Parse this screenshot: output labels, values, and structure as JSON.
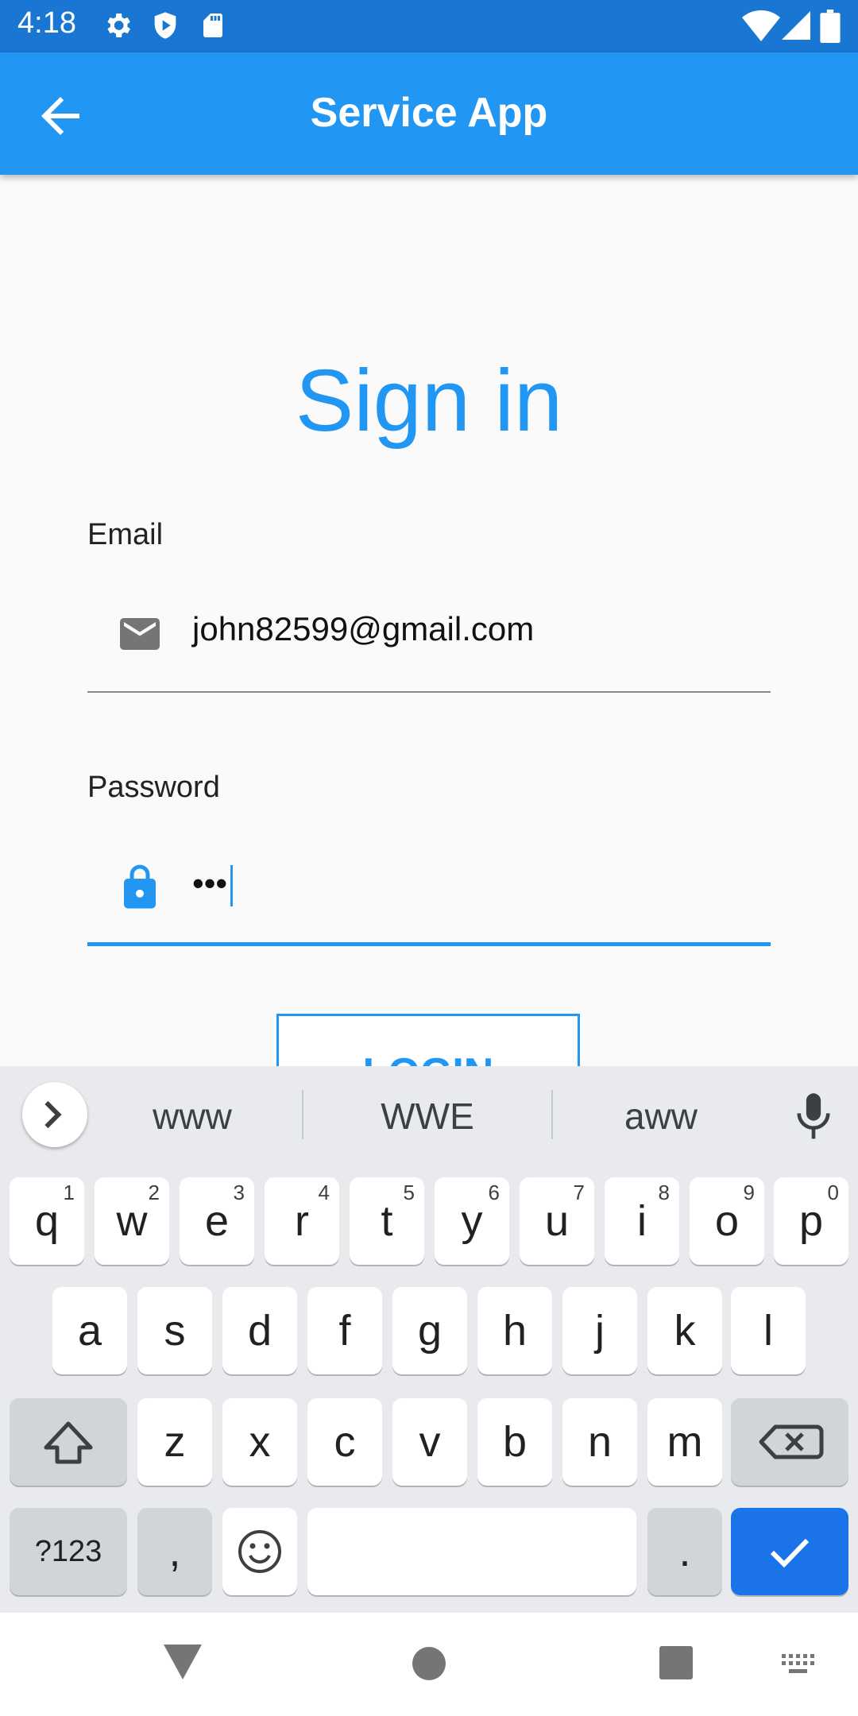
{
  "status_bar": {
    "time": "4:18",
    "icons": [
      "gear-icon",
      "shield-icon",
      "sd-card-icon",
      "wifi-icon",
      "signal-icon",
      "battery-icon"
    ]
  },
  "app_bar": {
    "title": "Service App",
    "back_icon": "arrow-left-icon"
  },
  "form": {
    "heading": "Sign in",
    "email": {
      "label": "Email",
      "value": "john82599@gmail.com",
      "icon": "mail-icon"
    },
    "password": {
      "label": "Password",
      "value": "•••",
      "icon": "lock-icon"
    },
    "login_button": "LOGIN"
  },
  "keyboard": {
    "suggestions": [
      "www",
      "WWE",
      "aww"
    ],
    "row1": [
      "q",
      "w",
      "e",
      "r",
      "t",
      "y",
      "u",
      "i",
      "o",
      "p"
    ],
    "row1_hints": [
      "1",
      "2",
      "3",
      "4",
      "5",
      "6",
      "7",
      "8",
      "9",
      "0"
    ],
    "row2": [
      "a",
      "s",
      "d",
      "f",
      "g",
      "h",
      "j",
      "k",
      "l"
    ],
    "row3": [
      "z",
      "x",
      "c",
      "v",
      "b",
      "n",
      "m"
    ],
    "symbols_key": "?123",
    "comma_key": ",",
    "period_key": "."
  },
  "colors": {
    "status_bar": "#1976d2",
    "app_bar": "#2196f3",
    "accent": "#2196f3",
    "action_key": "#1a73e8",
    "keyboard_bg": "#e8eaed"
  }
}
